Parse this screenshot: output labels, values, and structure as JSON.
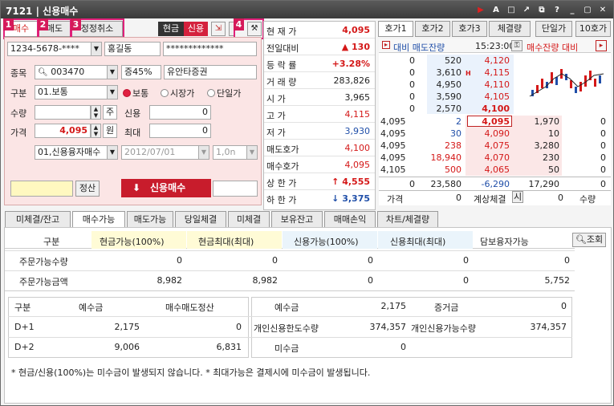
{
  "window": {
    "id": "7121",
    "title": "신용매수"
  },
  "title_icons": [
    "play-icon",
    "font-icon",
    "window-icon",
    "popout-icon",
    "restore-icon",
    "help-icon",
    "minimize-icon",
    "maximize-icon",
    "close-icon"
  ],
  "top_tabs": [
    {
      "num": "1",
      "label": "매수"
    },
    {
      "num": "2",
      "label": "매도"
    },
    {
      "num": "3",
      "label": "정정취소"
    }
  ],
  "toggle": {
    "cash": "현금",
    "credit": "신용"
  },
  "tool4_num": "4",
  "account": {
    "number": "1234-5678-****",
    "name": "홍길동",
    "password": "*************"
  },
  "stock": {
    "label": "종목",
    "code": "003470",
    "margin": "증45%",
    "name": "유안타증권"
  },
  "order_type": {
    "label": "구분",
    "value": "01.보통",
    "radios": [
      "보통",
      "시장가",
      "단일가"
    ]
  },
  "qty": {
    "label": "수량",
    "unit": "주",
    "value": ""
  },
  "price": {
    "label": "가격",
    "value": "4,095",
    "unit": "원"
  },
  "credit": {
    "label": "신용",
    "value": "0",
    "max_label": "최대",
    "max_value": "0"
  },
  "loan": {
    "type": "01,신용융자매수",
    "date": "2012/07/01",
    "term": "1,0n"
  },
  "settle_btn": "정산",
  "buy_btn": "신용매수",
  "quote": [
    {
      "k": "현 재 가",
      "v": "4,095",
      "c": "red"
    },
    {
      "k": "전일대비",
      "v": "▲ 130",
      "c": "red"
    },
    {
      "k": "등 락 률",
      "v": "+3.28%",
      "c": "red"
    },
    {
      "k": "거 래 량",
      "v": "283,826",
      "c": ""
    },
    {
      "k": "시    가",
      "v": "3,965",
      "c": ""
    },
    {
      "k": "고    가",
      "v": "4,115",
      "c": "red"
    },
    {
      "k": "저    가",
      "v": "3,930",
      "c": "blue"
    },
    {
      "k": "매도호가",
      "v": "4,100",
      "c": "red"
    },
    {
      "k": "매수호가",
      "v": "4,095",
      "c": "red"
    },
    {
      "k": "상 한 가",
      "v": "↑ 4,555",
      "c": "red"
    },
    {
      "k": "하 한 가",
      "v": "↓ 3,375",
      "c": "blue"
    }
  ],
  "ob_tabs": [
    "호가1",
    "호가2",
    "호가3",
    "체결량"
  ],
  "ob_extra": [
    "단일가",
    "10호가"
  ],
  "ob_head": {
    "left": "대비 매도잔량",
    "time": "15:23:00",
    "right": "매수잔량 대비"
  },
  "asks": [
    {
      "d": "0",
      "q": "520",
      "p": "4,120"
    },
    {
      "d": "0",
      "q": "3,610",
      "p": "4,115"
    },
    {
      "d": "0",
      "q": "4,950",
      "p": "4,110"
    },
    {
      "d": "0",
      "q": "3,590",
      "p": "4,105"
    },
    {
      "d": "0",
      "q": "2,570",
      "p": "4,100"
    }
  ],
  "mids": [
    {
      "a": "4,095",
      "b": "2",
      "p": "4,095",
      "bq": "1,970",
      "bd": "0"
    },
    {
      "a": "4,095",
      "b": "30",
      "p": "4,090",
      "bq": "10",
      "bd": "0"
    },
    {
      "a": "4,095",
      "b": "238",
      "p": "4,075",
      "bq": "3,280",
      "bd": "0"
    },
    {
      "a": "4,095",
      "b": "18,940",
      "p": "4,070",
      "bq": "230",
      "bd": "0"
    },
    {
      "a": "4,105",
      "b": "500",
      "p": "4,065",
      "bq": "50",
      "bd": "0"
    }
  ],
  "ob_totals": {
    "d": "0",
    "ask": "23,580",
    "diff": "-6,290",
    "bid": "17,290",
    "bd": "0"
  },
  "ob_footer": {
    "price_label": "가격",
    "price_val": "0",
    "calc_label": "계상체결",
    "si": "시",
    "qty_val": "0",
    "qty_label": "수량"
  },
  "bottom_tabs": [
    "미체결/잔고",
    "매수가능",
    "매도가능",
    "당일체결",
    "미체결",
    "보유잔고",
    "매매손익",
    "차트/체결량"
  ],
  "query_btn": "조회",
  "table1": {
    "head": [
      "구분",
      "현금가능(100%)",
      "현금최대(최대)",
      "신용가능(100%)",
      "신용최대(최대)",
      "담보융자가능"
    ],
    "rows": [
      [
        "주문가능수량",
        "0",
        "0",
        "0",
        "0",
        "0"
      ],
      [
        "주문가능금액",
        "8,982",
        "8,982",
        "0",
        "0",
        "5,752"
      ]
    ]
  },
  "table2": {
    "head": [
      "구분",
      "예수금",
      "매수매도정산",
      "예수금",
      "2,175",
      "증거금",
      "0"
    ],
    "rows": [
      [
        "D+1",
        "2,175",
        "0",
        "개인신용한도수량",
        "374,357",
        "개인신용가능수량",
        "374,357"
      ],
      [
        "D+2",
        "9,006",
        "6,831",
        "미수금",
        "0",
        "",
        ""
      ]
    ]
  },
  "note": "* 현금/신용(100%)는 미수금이 발생되지 않습니다. * 최대가능은 결제시에 미수금이 발생됩니다.",
  "colors": {
    "red": "#d41818",
    "blue": "#1f4ea8",
    "accent": "#e0207a",
    "credit_bg": "#d4213d"
  }
}
